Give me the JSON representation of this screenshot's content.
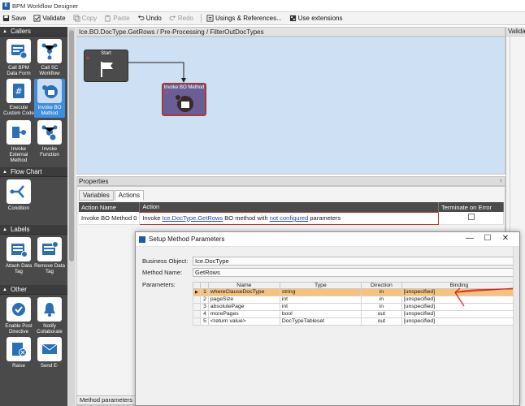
{
  "window": {
    "title": "BPM Workflow Designer"
  },
  "toolbar": {
    "save": "Save",
    "validate": "Validate",
    "copy": "Copy",
    "paste": "Paste",
    "undo": "Undo",
    "redo": "Redo",
    "usings": "Usings & References...",
    "use_extensions": "Use extensions"
  },
  "toolbox": {
    "callers": {
      "header": "Callers",
      "items": [
        "Call BPM Data Form",
        "Call SC Workflow",
        "Execute Custom Code",
        "Invoke BO Method",
        "Invoke External Method",
        "Invoke Function"
      ]
    },
    "flowchart": {
      "header": "Flow Chart",
      "items": [
        "Condition"
      ]
    },
    "labels": {
      "header": "Labels",
      "items": [
        "Attach Data Tag",
        "Remove Data Tag"
      ]
    },
    "other": {
      "header": "Other",
      "items": [
        "Enable Post Directive",
        "Notify Collaborate",
        "Raise",
        "Send E-"
      ]
    }
  },
  "canvas": {
    "path": "Ice.BO.DocType.GetRows / Pre-Processing / FilterOutDocTypes",
    "start_label": "Start",
    "invoke_label": "Invoke BO Method"
  },
  "right_panel": {
    "title": "Valida"
  },
  "properties": {
    "title": "Properties",
    "pin": "↑",
    "tabs": [
      "Variables",
      "Actions"
    ],
    "columns": [
      "Action Name",
      "Action",
      "Terminate on Error"
    ],
    "row": {
      "name": "Invoke BO Method 0",
      "action_prefix": "Invoke ",
      "action_link1": "Ice.DocType.GetRows",
      "action_mid": " BO method with ",
      "action_link2": "not configured",
      "action_suffix": " parameters"
    },
    "bottom_tab": "Method parameters"
  },
  "dialog": {
    "title": "Setup Method Parameters",
    "business_object_label": "Business Object:",
    "business_object_value": "Ice.DocType",
    "method_name_label": "Method Name:",
    "method_name_value": "GetRows",
    "parameters_label": "Parameters:",
    "columns": [
      "Name",
      "Type",
      "Direction",
      "Binding"
    ],
    "rows": [
      {
        "num": "1",
        "name": "whereClauseDocType",
        "type": "string",
        "direction": "in",
        "binding": "[unspecified]"
      },
      {
        "num": "2",
        "name": "pageSize",
        "type": "int",
        "direction": "in",
        "binding": "[unspecified]"
      },
      {
        "num": "3",
        "name": "absolutePage",
        "type": "int",
        "direction": "in",
        "binding": "[unspecified]"
      },
      {
        "num": "4",
        "name": "morePages",
        "type": "bool",
        "direction": "out",
        "binding": "[unspecified]"
      },
      {
        "num": "5",
        "name": "<return value>",
        "type": "DocTypeTableset",
        "direction": "out",
        "binding": "[unspecified]"
      }
    ]
  },
  "colors": {
    "accent": "#3e8ee0",
    "canvas_bg": "#cde0f4",
    "annotation": "#e0201a",
    "selected_row": "#f7c27a"
  }
}
